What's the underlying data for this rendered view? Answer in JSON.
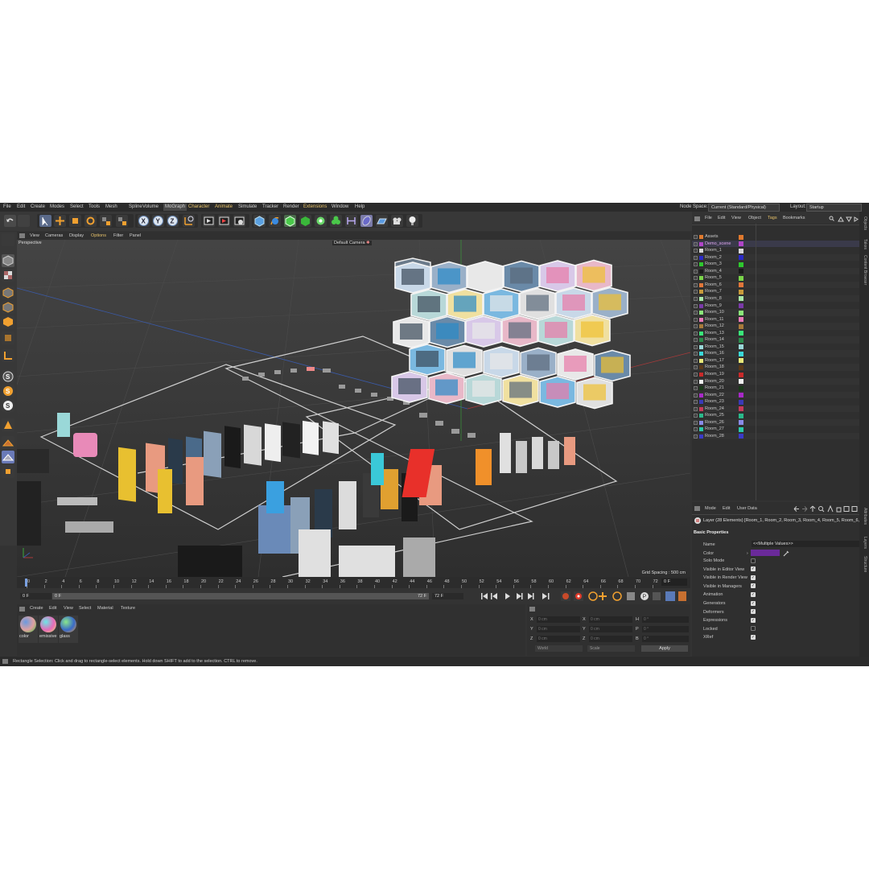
{
  "menubar": {
    "items": [
      "File",
      "Edit",
      "Create",
      "Modes",
      "Select",
      "Tools",
      "Mesh",
      "Spline",
      "Volume",
      "MoGraph",
      "Character",
      "Animate",
      "Simulate",
      "Tracker",
      "Render",
      "Extensions",
      "Window",
      "Help"
    ],
    "node_space_label": "Node Space:",
    "node_space_value": "Current (Standard/Physical)",
    "layout_label": "Layout:",
    "layout_value": "Startup"
  },
  "viewport": {
    "menu": [
      "View",
      "Cameras",
      "Display",
      "Options",
      "Filter",
      "Panel"
    ],
    "label": "Perspective",
    "camera": "Default Camera",
    "grid_spacing": "Grid Spacing : 500 cm"
  },
  "timeline": {
    "ticks": [
      "0",
      "2",
      "4",
      "6",
      "8",
      "10",
      "12",
      "14",
      "16",
      "18",
      "20",
      "22",
      "24",
      "26",
      "28",
      "30",
      "32",
      "34",
      "36",
      "38",
      "40",
      "42",
      "44",
      "46",
      "48",
      "50",
      "52",
      "54",
      "56",
      "58",
      "60",
      "62",
      "64",
      "66",
      "68",
      "70",
      "72"
    ],
    "end_frame": "0 F",
    "start_field": "0 F",
    "current_field": "0 F",
    "max_field": "72 F",
    "max_field2": "72 F"
  },
  "material": {
    "menu": [
      "Create",
      "Edit",
      "View",
      "Select",
      "Material",
      "Texture"
    ],
    "items": [
      {
        "name": "color"
      },
      {
        "name": "emissive"
      },
      {
        "name": "glass"
      }
    ]
  },
  "coords": {
    "rows": [
      {
        "axis": "X",
        "pos": "0 cm",
        "axis2": "X",
        "size": "0 cm",
        "axis3": "H",
        "rot": "0 °"
      },
      {
        "axis": "Y",
        "pos": "0 cm",
        "axis2": "Y",
        "size": "0 cm",
        "axis3": "P",
        "rot": "0 °"
      },
      {
        "axis": "Z",
        "pos": "0 cm",
        "axis2": "Z",
        "size": "0 cm",
        "axis3": "B",
        "rot": "0 °"
      }
    ],
    "mode1": "World",
    "mode2": "Scale",
    "apply": "Apply"
  },
  "status": "Rectangle Selection: Click and drag to rectangle-select elements. Hold down SHIFT to add to the selection. CTRL to remove.",
  "objects": {
    "menu": [
      "File",
      "Edit",
      "View",
      "Object",
      "Tags",
      "Bookmarks"
    ],
    "rows": [
      {
        "name": "Assets",
        "color": "#e07a2e",
        "sel": false
      },
      {
        "name": "Demo_scene",
        "color": "#b044c8",
        "sel": true
      },
      {
        "name": "Room_1",
        "color": "#d8d8d8",
        "sel": false
      },
      {
        "name": "Room_2",
        "color": "#2a2ac8",
        "sel": false
      },
      {
        "name": "Room_3",
        "color": "#2ec82e",
        "sel": false
      },
      {
        "name": "Room_4",
        "color": "#1a1a1a",
        "sel": false
      },
      {
        "name": "Room_5",
        "color": "#7ad44a",
        "sel": false
      },
      {
        "name": "Room_6",
        "color": "#e0763a",
        "sel": false
      },
      {
        "name": "Room_7",
        "color": "#c89a3a",
        "sel": false
      },
      {
        "name": "Room_8",
        "color": "#a8e8a8",
        "sel": false
      },
      {
        "name": "Room_9",
        "color": "#7a3aa8",
        "sel": false
      },
      {
        "name": "Room_10",
        "color": "#8ae87a",
        "sel": false
      },
      {
        "name": "Room_11",
        "color": "#e878b8",
        "sel": false
      },
      {
        "name": "Room_12",
        "color": "#a87a3a",
        "sel": false
      },
      {
        "name": "Room_13",
        "color": "#3ae87a",
        "sel": false
      },
      {
        "name": "Room_14",
        "color": "#2a8a4a",
        "sel": false
      },
      {
        "name": "Room_15",
        "color": "#9ad8d8",
        "sel": false
      },
      {
        "name": "Room_16",
        "color": "#3ad8d8",
        "sel": false
      },
      {
        "name": "Room_17",
        "color": "#e8e87a",
        "sel": false
      },
      {
        "name": "Room_18",
        "color": "#5a3a1a",
        "sel": false
      },
      {
        "name": "Room_19",
        "color": "#c82a2a",
        "sel": false
      },
      {
        "name": "Room_20",
        "color": "#f0f0f0",
        "sel": false
      },
      {
        "name": "Room_21",
        "color": "#1a3a1a",
        "sel": false
      },
      {
        "name": "Room_22",
        "color": "#a82ac8",
        "sel": false
      },
      {
        "name": "Room_23",
        "color": "#3a3ab8",
        "sel": false
      },
      {
        "name": "Room_24",
        "color": "#c83a5a",
        "sel": false
      },
      {
        "name": "Room_25",
        "color": "#2ab88a",
        "sel": false
      },
      {
        "name": "Room_26",
        "color": "#8a8ae8",
        "sel": false
      },
      {
        "name": "Room_27",
        "color": "#2ac8a8",
        "sel": false
      },
      {
        "name": "Room_28",
        "color": "#3a3ac8",
        "sel": false
      }
    ]
  },
  "attributes": {
    "menu": [
      "Mode",
      "Edit",
      "User Data"
    ],
    "layer_title": "Layer (28 Elements) [Room_1, Room_2, Room_3, Room_4, Room_5, Room_6,",
    "section": "Basic Properties",
    "name_label": "Name",
    "name_value": "<<Multiple Values>>",
    "color_label": "Color",
    "props": [
      {
        "label": "Solo Mode",
        "checked": false
      },
      {
        "label": "Visible in Editor View",
        "checked": true
      },
      {
        "label": "Visible in Render View",
        "checked": true
      },
      {
        "label": "Visible in Managers",
        "checked": true
      },
      {
        "label": "Animation",
        "checked": true
      },
      {
        "label": "Generators",
        "checked": true
      },
      {
        "label": "Deformers",
        "checked": true
      },
      {
        "label": "Expressions",
        "checked": true
      },
      {
        "label": "Locked",
        "checked": false
      },
      {
        "label": "XRef",
        "checked": true
      }
    ]
  },
  "side_tabs": [
    "Objects",
    "Takes",
    "Content Browser",
    "Attributes",
    "Layers",
    "Structure"
  ]
}
